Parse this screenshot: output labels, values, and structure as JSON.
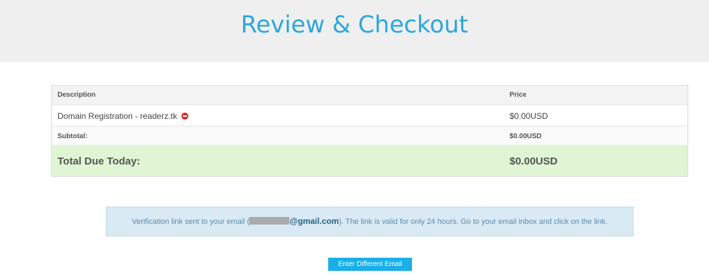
{
  "header": {
    "title": "Review & Checkout"
  },
  "cart": {
    "columns": {
      "description": "Description",
      "price": "Price"
    },
    "items": [
      {
        "description": "Domain Registration - readerz.tk",
        "price": "$0.00USD",
        "remove_icon": "remove-icon"
      }
    ],
    "subtotal": {
      "label": "Subtotal:",
      "value": "$0.00USD"
    },
    "total": {
      "label": "Total Due Today:",
      "value": "$0.00USD"
    }
  },
  "alert": {
    "prefix": "Verification link sent to your email (",
    "email_domain": "@gmail.com",
    "suffix": "). The link is valid for only 24 hours. Go to your email inbox and click on the link."
  },
  "actions": {
    "change_email_label": "Enter Different Email"
  },
  "colors": {
    "accent": "#2ba7de",
    "button": "#1baee8",
    "total_bg": "#dff5d3",
    "alert_bg": "#daeaf4",
    "remove": "#e1251b"
  }
}
